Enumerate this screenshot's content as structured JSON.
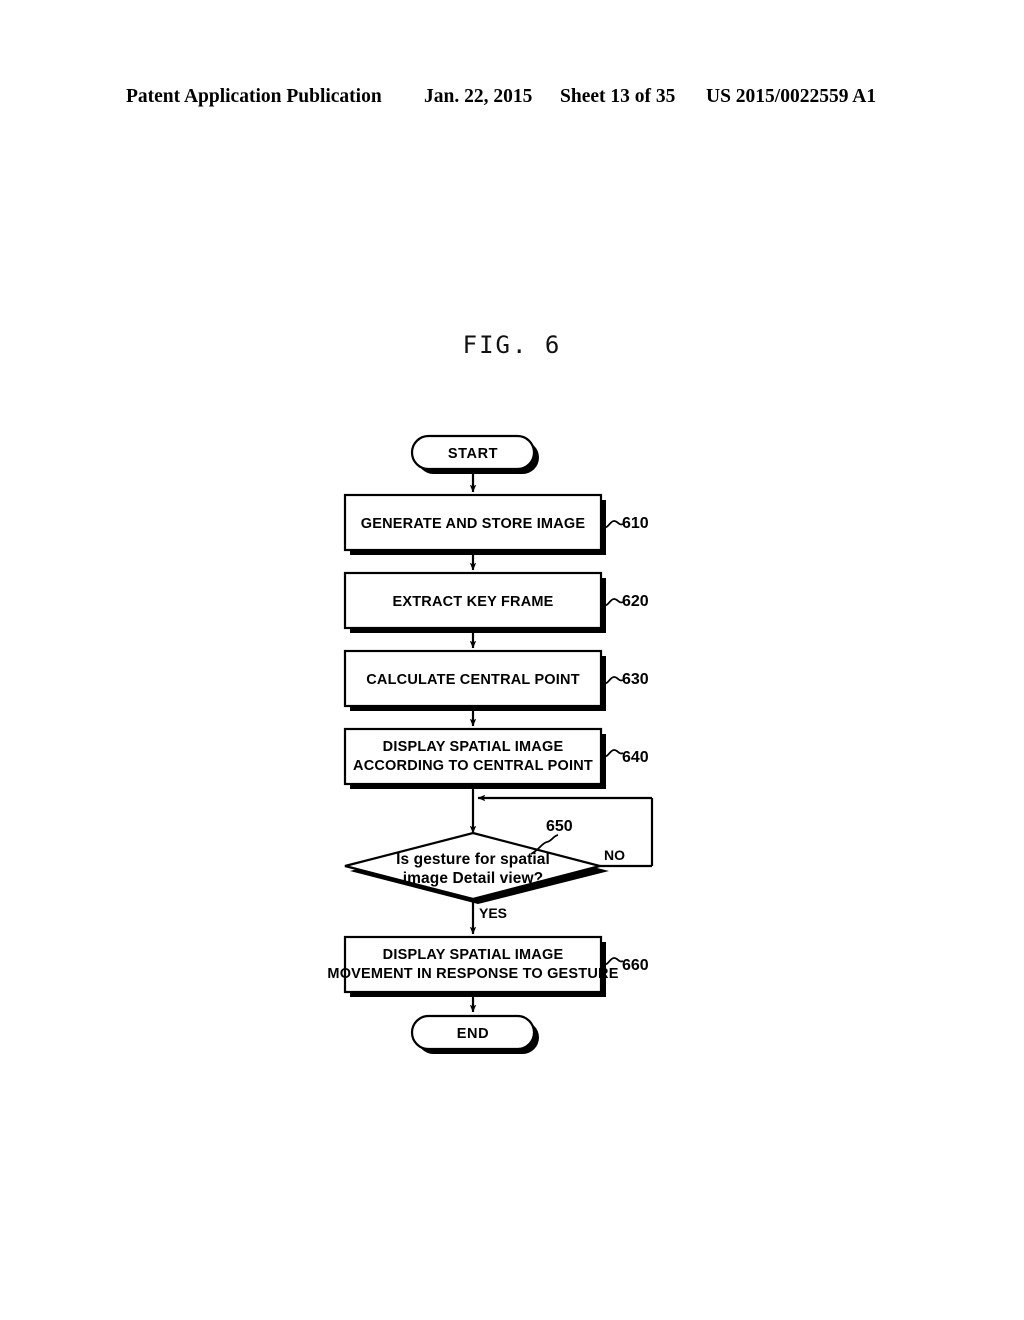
{
  "header": {
    "publication": "Patent Application Publication",
    "date": "Jan. 22, 2015",
    "sheet": "Sheet 13 of 35",
    "document_number": "US 2015/0022559 A1"
  },
  "figure": {
    "title": "FIG. 6"
  },
  "flowchart": {
    "start_label": "START",
    "end_label": "END",
    "branch_yes": "YES",
    "branch_no": "NO",
    "steps": [
      {
        "ref": "610",
        "line1": "GENERATE AND STORE IMAGE",
        "line2": ""
      },
      {
        "ref": "620",
        "line1": "EXTRACT KEY FRAME",
        "line2": ""
      },
      {
        "ref": "630",
        "line1": "CALCULATE CENTRAL POINT",
        "line2": ""
      },
      {
        "ref": "640",
        "line1": "DISPLAY SPATIAL IMAGE",
        "line2": "ACCORDING TO CENTRAL POINT"
      },
      {
        "ref": "660",
        "line1": "DISPLAY SPATIAL IMAGE",
        "line2": "MOVEMENT IN RESPONSE TO GESTURE"
      }
    ],
    "decision": {
      "ref": "650",
      "line1": "Is gesture for spatial",
      "line2": "image Detail view?"
    },
    "colors": {
      "line": "#000000",
      "fill": "#ffffff",
      "text": "#000000"
    }
  }
}
